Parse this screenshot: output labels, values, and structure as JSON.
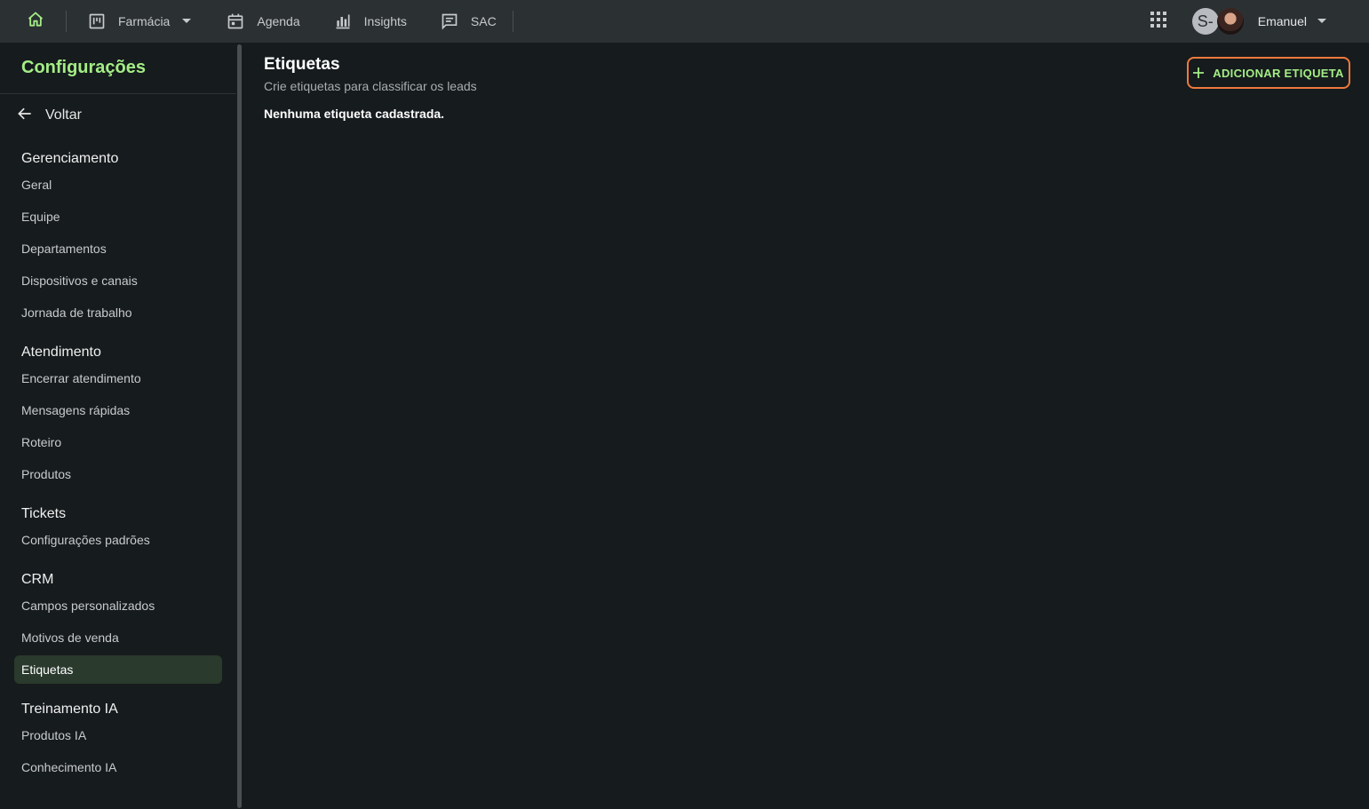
{
  "topbar": {
    "icons": {
      "home": "home-icon",
      "apps": "apps-grid-icon"
    },
    "nav": {
      "farmacia": "Farmácia",
      "agenda": "Agenda",
      "insights": "Insights",
      "sac": "SAC"
    },
    "user": {
      "avatar_letter": "S-",
      "name": "Emanuel"
    }
  },
  "sidebar": {
    "title": "Configurações",
    "back_label": "Voltar",
    "sections": {
      "gerenciamento": {
        "title": "Gerenciamento",
        "items": [
          "Geral",
          "Equipe",
          "Departamentos",
          "Dispositivos e canais",
          "Jornada de trabalho"
        ]
      },
      "atendimento": {
        "title": "Atendimento",
        "items": [
          "Encerrar atendimento",
          "Mensagens rápidas",
          "Roteiro",
          "Produtos"
        ]
      },
      "tickets": {
        "title": "Tickets",
        "items": [
          "Configurações padrões"
        ]
      },
      "crm": {
        "title": "CRM",
        "items": [
          "Campos personalizados",
          "Motivos de venda",
          "Etiquetas"
        ]
      },
      "treinamento": {
        "title": "Treinamento IA",
        "items": [
          "Produtos IA",
          "Conhecimento IA"
        ]
      }
    },
    "active_item": "Etiquetas"
  },
  "main": {
    "title": "Etiquetas",
    "subtitle": "Crie etiquetas para classificar os leads",
    "empty_message": "Nenhuma etiqueta cadastrada.",
    "add_button_label": "ADICIONAR ETIQUETA"
  },
  "colors": {
    "accent_green": "#a4ed86",
    "highlight_orange": "#ee7a3e",
    "background": "#161b1d",
    "topbar": "#2b3033",
    "active_item_bg": "#2a3a2d"
  }
}
